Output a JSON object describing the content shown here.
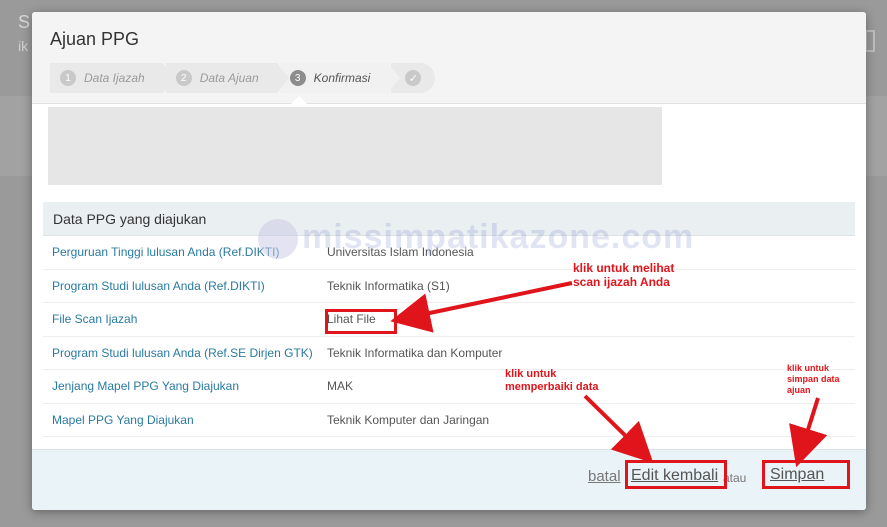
{
  "background": {
    "title": "S",
    "subtitle": "ik"
  },
  "modal": {
    "title": "Ajuan PPG",
    "wizard": [
      {
        "num": "1",
        "label": "Data Ijazah"
      },
      {
        "num": "2",
        "label": "Data Ajuan"
      },
      {
        "num": "3",
        "label": "Konfirmasi"
      }
    ],
    "done_icon": "check-icon"
  },
  "panel": {
    "heading": "Data PPG yang diajukan",
    "rows": [
      {
        "label": "Perguruan Tinggi lulusan Anda (Ref.DIKTI)",
        "value": "Universitas Islam Indonesia"
      },
      {
        "label": "Program Studi lulusan Anda (Ref.DIKTI)",
        "value": "Teknik Informatika (S1)"
      },
      {
        "label": "File Scan Ijazah",
        "value": "Lihat File"
      },
      {
        "label": "Program Studi lulusan Anda (Ref.SE Dirjen GTK)",
        "value": "Teknik Informatika dan Komputer"
      },
      {
        "label": "Jenjang Mapel PPG Yang Diajukan",
        "value": "MAK"
      },
      {
        "label": "Mapel PPG Yang Diajukan",
        "value": "Teknik Komputer dan Jaringan"
      }
    ]
  },
  "watermark": "missimpatikazone.com",
  "footer": {
    "cancel": "batal",
    "edit": "Edit kembali",
    "or": "atau",
    "save": "Simpan"
  },
  "annotations": {
    "view_scan": "klik untuk melihat\nscan ijazah Anda",
    "fix_data": "klik untuk\nmemperbaiki data",
    "save_data": "klik untuk\nsimpan data\najuan"
  },
  "colors": {
    "accent_red": "#e0151b",
    "link_blue": "#2a7aa0",
    "footer_bg": "#eaf3f8"
  }
}
